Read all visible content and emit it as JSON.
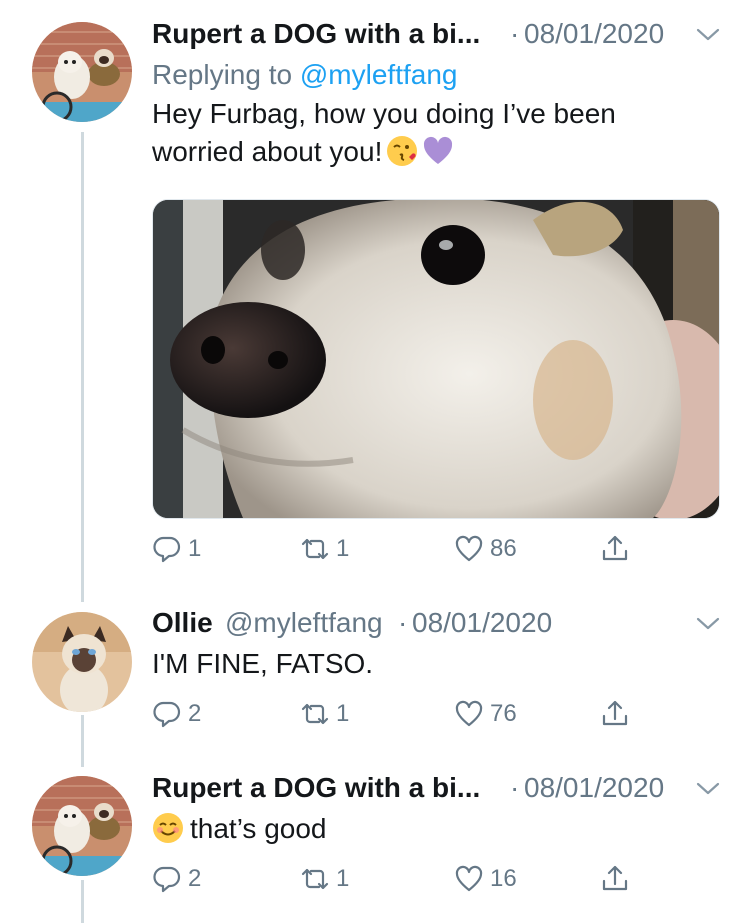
{
  "tweets": [
    {
      "name": "Rupert a DOG with a bi...",
      "date": "08/01/2020",
      "replying_prefix": "Replying to",
      "replying_handle": "@myleftfang",
      "text_line1": "Hey Furbag, how you doing I’ve been",
      "text_line2": "worried about you!",
      "emojis": [
        "kissing-face-emoji",
        "purple-heart-emoji"
      ],
      "reply_count": "1",
      "retweet_count": "1",
      "like_count": "86"
    },
    {
      "name": "Ollie",
      "handle": "@myleftfang",
      "date": "08/01/2020",
      "text": "I'M FINE, FATSO.",
      "reply_count": "2",
      "retweet_count": "1",
      "like_count": "76"
    },
    {
      "name": "Rupert a DOG with a bi...",
      "date": "08/01/2020",
      "text": "that’s good",
      "emojis": [
        "smiling-face-emoji"
      ],
      "reply_count": "2",
      "retweet_count": "1",
      "like_count": "16"
    }
  ],
  "separator": "·",
  "colors": {
    "name": "#14171a",
    "secondary": "#657786",
    "link": "#1da1f2",
    "thread_line": "#cfd9de"
  },
  "icons": [
    "reply-icon",
    "retweet-icon",
    "like-icon",
    "share-icon",
    "chevron-down-icon"
  ]
}
